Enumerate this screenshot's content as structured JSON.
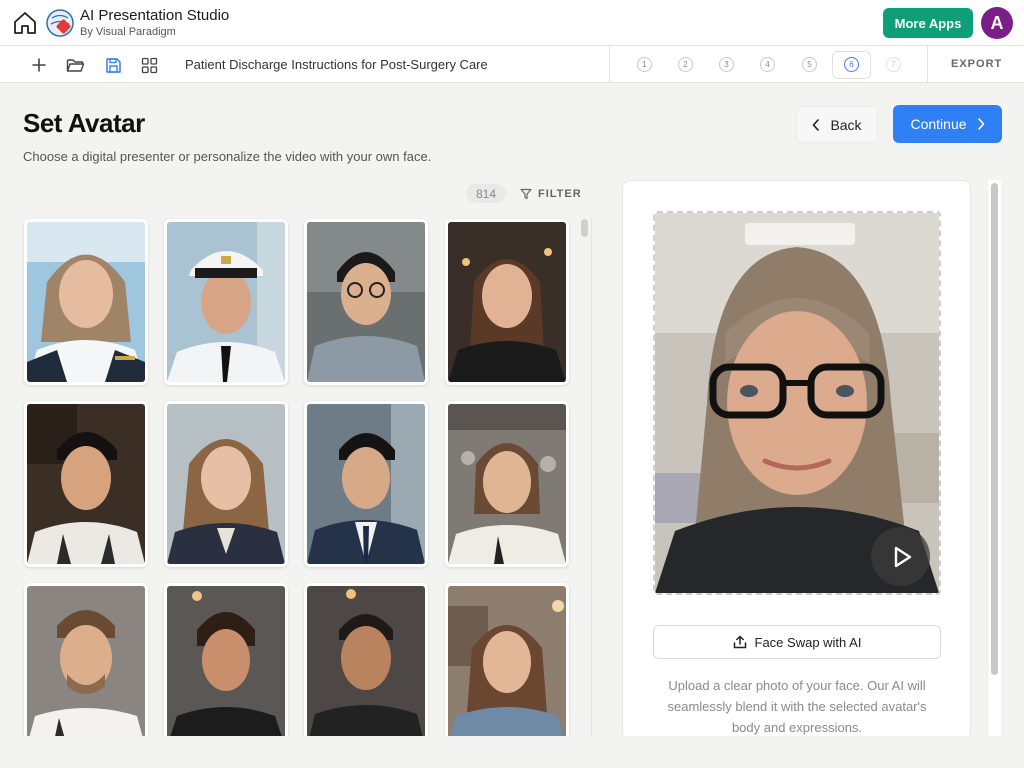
{
  "app": {
    "title": "AI Presentation Studio",
    "subtitle": "By Visual Paradigm",
    "more_apps": "More Apps",
    "user_initial": "A",
    "accent": "#0e9f77",
    "user_color": "#7a1f87"
  },
  "toolbar": {
    "icons": [
      "plus-icon",
      "folder-icon",
      "save-icon",
      "grid-icon"
    ],
    "doc_title": "Patient Discharge Instructions for Post-Surgery Care",
    "steps": [
      "1",
      "2",
      "3",
      "4",
      "5",
      "6",
      "7"
    ],
    "active_step": "6",
    "export": "EXPORT"
  },
  "header": {
    "title": "Set Avatar",
    "subtitle": "Choose a digital presenter or personalize the video with your own face.",
    "back": "Back",
    "continue": "Continue",
    "continue_color": "#2f80f5"
  },
  "gallery": {
    "count": "814",
    "filter": "FILTER",
    "avatars": [
      {
        "desc": "pilot-woman"
      },
      {
        "desc": "pilot-man"
      },
      {
        "desc": "man-glasses"
      },
      {
        "desc": "woman-cafe"
      },
      {
        "desc": "young-man-apron"
      },
      {
        "desc": "woman-blazer"
      },
      {
        "desc": "man-suit"
      },
      {
        "desc": "woman-kitchen"
      },
      {
        "desc": "chef-man"
      },
      {
        "desc": "woman-gym"
      },
      {
        "desc": "man-gym"
      },
      {
        "desc": "girl-denim"
      }
    ]
  },
  "preview": {
    "face_swap": "Face Swap with AI",
    "description": "Upload a clear photo of your face. Our AI will seamlessly blend it with the selected avatar's body and expressions."
  }
}
